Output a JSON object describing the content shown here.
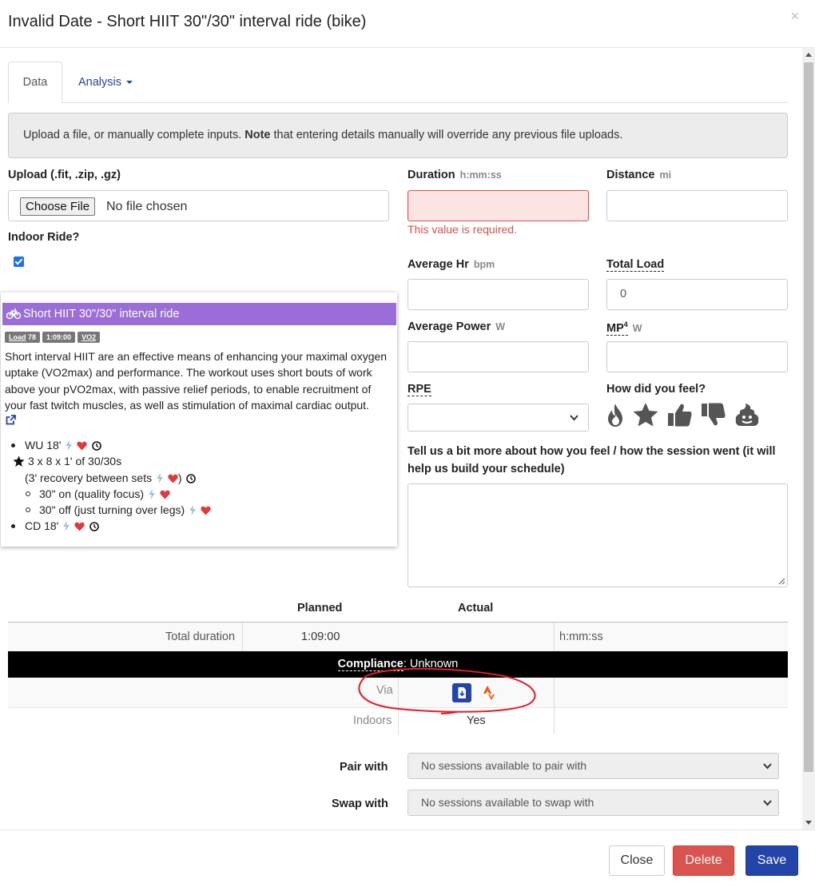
{
  "modal": {
    "title": "Invalid Date - Short HIIT 30\"/30\" interval ride (bike)",
    "close_symbol": "×"
  },
  "tabs": [
    {
      "label": "Data",
      "active": true
    },
    {
      "label": "Analysis",
      "dropdown": true
    }
  ],
  "note": {
    "prefix": "Upload a file, or manually complete inputs. ",
    "bold": "Note",
    "suffix": " that entering details manually will override any previous file uploads."
  },
  "upload": {
    "label": "Upload (.fit, .zip, .gz)",
    "button": "Choose File",
    "status": "No file chosen"
  },
  "indoor": {
    "label": "Indoor Ride?",
    "checked": true
  },
  "duration": {
    "label": "Duration",
    "unit": "h:mm:ss",
    "value": "",
    "error": "This value is required."
  },
  "distance": {
    "label": "Distance",
    "unit": "mi",
    "value": ""
  },
  "avg_hr": {
    "label": "Average Hr",
    "unit": "bpm",
    "value": ""
  },
  "total_load": {
    "label": "Total Load",
    "value": "0"
  },
  "avg_power": {
    "label": "Average Power",
    "unit": "W",
    "value": ""
  },
  "mp4": {
    "label": "MP",
    "sup": "4",
    "unit": "W",
    "value": ""
  },
  "rpe": {
    "label": "RPE",
    "value": ""
  },
  "feel": {
    "label": "How did you feel?",
    "icons": [
      "fire-icon",
      "star-icon",
      "thumbs-up-icon",
      "thumbs-down-icon",
      "poop-icon"
    ]
  },
  "comments": {
    "label": "Tell us a bit more about how you feel / how the session went (it will help us build your schedule)",
    "value": ""
  },
  "workout": {
    "title": "Short HIIT 30\"/30\" interval ride",
    "header_color": "#9b6dd8",
    "tags": {
      "load_label": "Load",
      "load_value": "78",
      "duration": "1:09:00",
      "zone": "VO2"
    },
    "description": "Short interval HIIT are an effective means of enhancing your maximal oxygen uptake (VO2max) and performance. The workout uses short bouts of work above your pVO2max, with passive relief periods, to enable recruitment of your fast twitch muscles, as well as stimulation of maximal cardiac output.",
    "steps": {
      "wu": "WU 18'",
      "main": "3 x 8 x 1' of 30/30s",
      "main_note": "(3' recovery between sets",
      "main_note_close": ")",
      "on": "30\" on (quality focus)",
      "off": "30\" off (just turning over legs)",
      "cd": "CD 18'"
    }
  },
  "summary": {
    "planned_header": "Planned",
    "actual_header": "Actual",
    "total_duration_label": "Total duration",
    "total_duration_planned": "1:09:00",
    "total_duration_unit": "h:mm:ss",
    "compliance_label": "Compliance",
    "compliance_value": ": Unknown",
    "via_label": "Via",
    "indoors_label": "Indoors",
    "indoors_value": "Yes"
  },
  "pair": {
    "label": "Pair with",
    "value": "No sessions available to pair with"
  },
  "swap": {
    "label": "Swap with",
    "value": "No sessions available to swap with"
  },
  "footer": {
    "close": "Close",
    "delete": "Delete",
    "save": "Save"
  },
  "colors": {
    "primary": "#2344a8",
    "danger": "#d9534f",
    "workout_purple": "#9b6dd8",
    "annotation_red": "#e8192c",
    "strava_orange": "#fc4c02"
  }
}
